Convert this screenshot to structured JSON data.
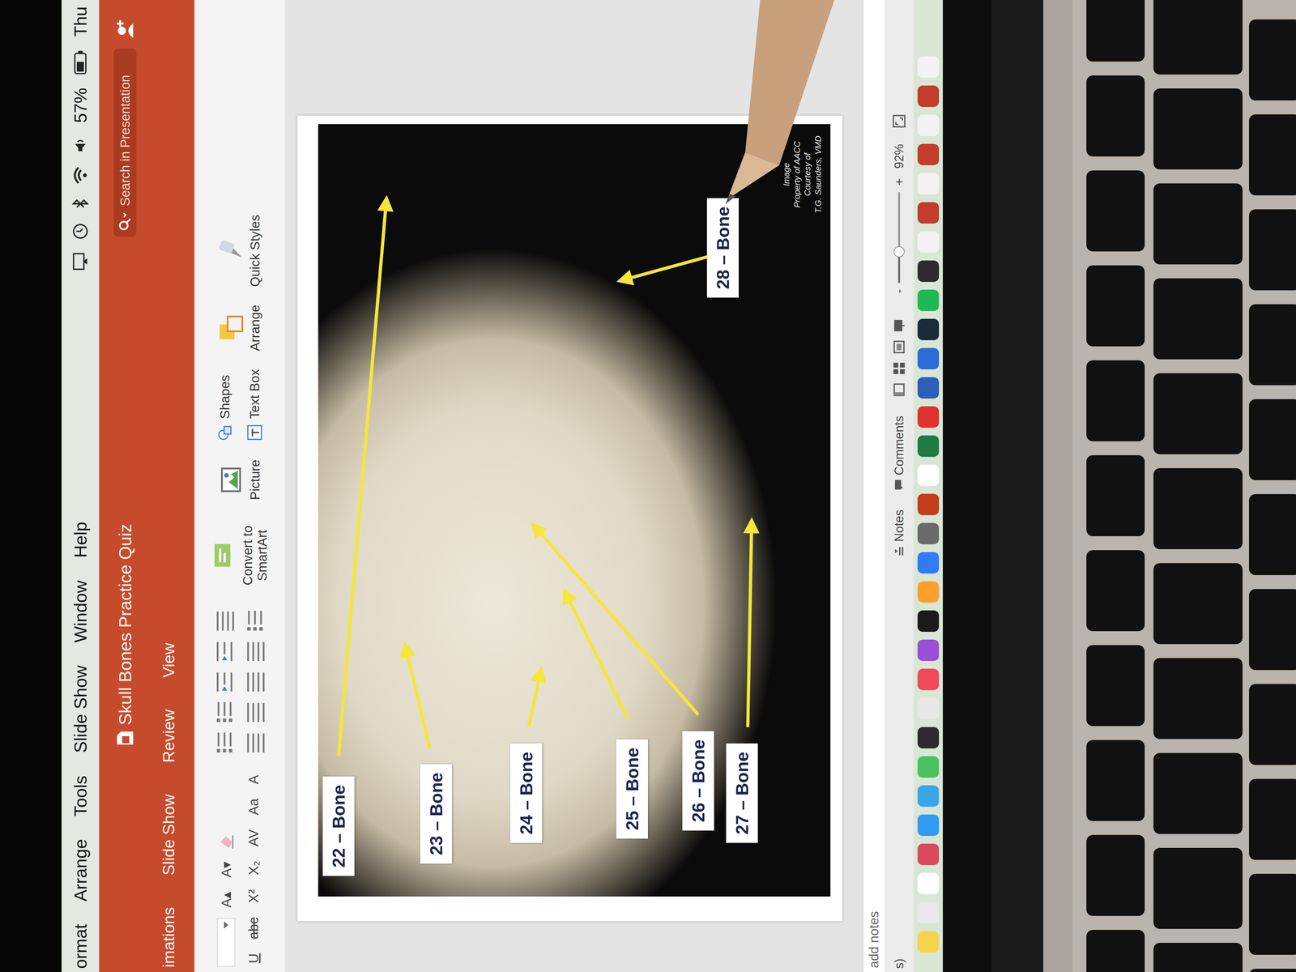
{
  "menubar": {
    "items": [
      "ormat",
      "Arrange",
      "Tools",
      "Slide Show",
      "Window",
      "Help"
    ],
    "battery": "57%",
    "clock": "Thu"
  },
  "titlebar": {
    "title": "Skull Bones Practice Quiz",
    "search": {
      "placeholder": "Search in Presentation"
    }
  },
  "ribbon": {
    "tabs": [
      {
        "label": "imations",
        "selected": false
      },
      {
        "label": "Slide Show",
        "selected": false
      },
      {
        "label": "Review",
        "selected": false
      },
      {
        "label": "View",
        "selected": false
      }
    ],
    "font_row1": [
      "A▴",
      "A▾"
    ],
    "font_row2": [
      "U",
      "abc",
      "X²",
      "X₂",
      "AV",
      "Aa",
      "A"
    ],
    "tools": [
      {
        "label": "Convert to SmartArt",
        "kind": "large"
      },
      {
        "label": "Picture",
        "kind": "large"
      },
      {
        "label": "Shapes",
        "kind": "small"
      },
      {
        "label": "Text Box",
        "kind": "small"
      },
      {
        "label": "Arrange",
        "kind": "large"
      },
      {
        "label": "Quick Styles",
        "kind": "large"
      }
    ]
  },
  "slide": {
    "labels": [
      "22 – Bone",
      "23 – Bone",
      "24 – Bone",
      "25 – Bone",
      "26 – Bone",
      "27 – Bone",
      "28 – Bone"
    ],
    "credit": [
      "Image",
      "Property of AACC",
      "Courtesy of",
      "T.G. Saunders, VMD"
    ]
  },
  "notes": {
    "placeholder": "add notes"
  },
  "status_bar": {
    "language": "s)",
    "notes": "Notes",
    "comments": "Comments",
    "zoom_out": "-",
    "zoom_in": "+",
    "zoom": "92%",
    "zoom_level": 0.34
  }
}
